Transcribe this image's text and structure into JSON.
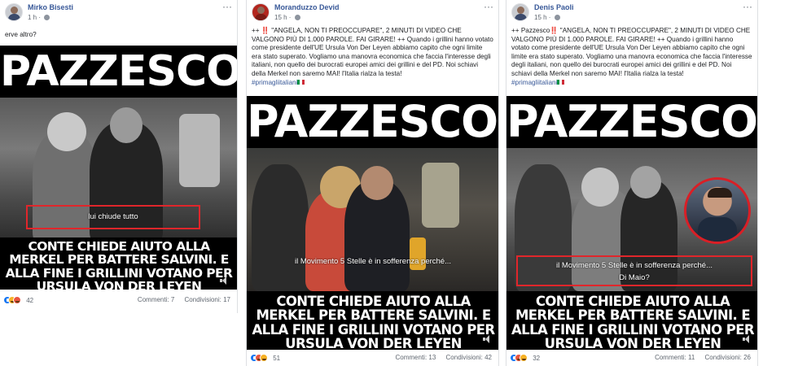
{
  "posts": [
    {
      "author": "Mirko Bisesti",
      "time": "1 h",
      "caption": "erve altro?",
      "video": {
        "title": "PAZZESCO!",
        "subtitle": "lui chiude tutto",
        "banner": "CONTE CHIEDE AIUTO ALLA MERKEL PER BATTERE SALVINI. E ALLA FINE I GRILLINI VOTANO PER URSULA VON DER LEYEN"
      },
      "reactions": [
        "like",
        "haha",
        "angry"
      ],
      "reaction_count": "42",
      "comments": "Commenti: 7",
      "shares": "Condivisioni: 17"
    },
    {
      "author": "Moranduzzo Devid",
      "time": "15 h",
      "caption": "++ ‼️ \"ANGELA, NON TI PREOCCUPARE\", 2 MINUTI DI VIDEO CHE VALGONO PIÙ DI 1.000 PAROLE. FAI GIRARE! ++ Quando i grillini hanno votato come presidente dell'UE Ursula Von Der Leyen abbiamo capito che ogni limite era stato superato. Vogliamo una manovra economica che faccia l'interesse degli italiani, non quello dei burocrati europei amici dei grillini e del PD. Noi schiavi della Merkel non saremo MAI! l'Italia rialza la testa!",
      "hashtag": "#primagliitaliani",
      "video": {
        "title": "PAZZESCO!",
        "subtitle": "il Movimento 5 Stelle è in sofferenza perché...",
        "banner": "CONTE CHIEDE AIUTO ALLA MERKEL PER BATTERE SALVINI. E ALLA FINE I GRILLINI VOTANO PER URSULA VON DER LEYEN"
      },
      "reactions": [
        "like",
        "angry",
        "wow"
      ],
      "reaction_count": "51",
      "comments": "Commenti: 13",
      "shares": "Condivisioni: 42"
    },
    {
      "author": "Denis Paoli",
      "time": "15 h",
      "caption": "++ Pazzesco‼️ \"ANGELA, NON TI PREOCCUPARE\", 2 MINUTI DI VIDEO CHE VALGONO PIÙ DI 1.000 PAROLE. FAI GIRARE! ++ Quando i grillini hanno votato come presidente dell'UE Ursula Von Der Leyen abbiamo capito che ogni limite era stato superato. Vogliamo una manovra economica che faccia l'interesse degli italiani, non quello dei burocrati europei amici dei grillini e del PD. Noi schiavi della Merkel non saremo MAI! l'Italia rialza la testa!",
      "hashtag": "#primagliitaliani",
      "video": {
        "title": "PAZZESCO!",
        "subtitle": "il Movimento 5 Stelle è in sofferenza perché...",
        "subtitle2": "Di Maio?",
        "banner": "CONTE CHIEDE AIUTO ALLA MERKEL PER BATTERE SALVINI. E ALLA FINE I GRILLINI VOTANO PER URSULA VON DER LEYEN"
      },
      "reactions": [
        "like",
        "angry",
        "haha"
      ],
      "reaction_count": "32",
      "comments": "Commenti: 11",
      "shares": "Condivisioni: 26"
    }
  ],
  "icons": {
    "menu": "more-options-icon",
    "privacy": "globe-icon",
    "sound": "sound-icon"
  }
}
